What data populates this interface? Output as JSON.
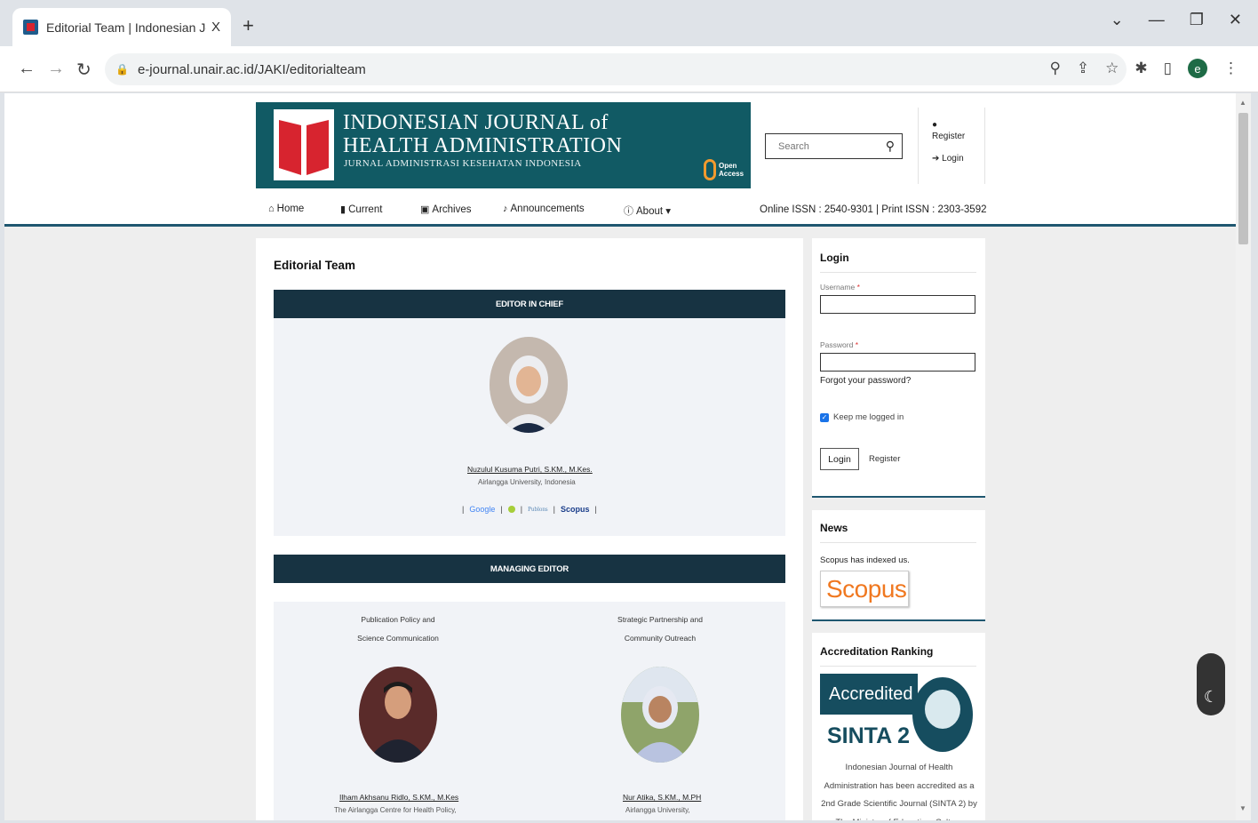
{
  "browser": {
    "tab_title": "Editorial Team | Indonesian Journ",
    "tab_close": "X",
    "new_tab": "+",
    "url": "e-journal.unair.ac.id/JAKI/editorialteam",
    "profile_initial": "e"
  },
  "journal": {
    "title_line1": "INDONESIAN JOURNAL of",
    "title_line2": "HEALTH ADMINISTRATION",
    "subtitle": "JURNAL ADMINISTRASI KESEHATAN INDONESIA",
    "open_access_line1": "Open",
    "open_access_line2": "Access"
  },
  "search": {
    "placeholder": "Search"
  },
  "user_menu": {
    "register": "Register",
    "login": "Login"
  },
  "nav": {
    "items": [
      {
        "label": "Home",
        "icon": "home-icon"
      },
      {
        "label": "Current",
        "icon": "book-icon"
      },
      {
        "label": "Archives",
        "icon": "archive-icon"
      },
      {
        "label": "Announcements",
        "icon": "bell-icon"
      },
      {
        "label": "About",
        "icon": "info-icon"
      }
    ],
    "about_caret": "▾",
    "issn": "Online ISSN : 2540-9301  |  Print ISSN : 2303-3592"
  },
  "main": {
    "page_title": "Editorial Team",
    "sections": [
      {
        "heading": "EDITOR IN CHIEF",
        "people": [
          {
            "name": "Nuzulul Kusuma Putri, S.KM., M.Kes.",
            "affiliation": "Airlangga University, Indonesia"
          }
        ],
        "profile_links": [
          "Google",
          "Publons",
          "Scopus"
        ],
        "link_sep": "|"
      },
      {
        "heading": "MANAGING EDITOR",
        "people": [
          {
            "role_line1": "Publication Policy and",
            "role_line2": "Science Communication",
            "name": "Ilham Akhsanu Ridlo, S.KM., M.Kes",
            "affiliation": "The Airlangga Centre for Health Policy,"
          },
          {
            "role_line1": "Strategic Partnership and",
            "role_line2": "Community Outreach",
            "name": "Nur Atika, S.KM., M.PH",
            "affiliation": "Airlangga University,"
          }
        ]
      }
    ]
  },
  "sidebar": {
    "login": {
      "title": "Login",
      "username_label": "Username",
      "password_label": "Password",
      "required_mark": "*",
      "forgot": "Forgot your password?",
      "keep_logged_in": "Keep me logged in",
      "login_button": "Login",
      "register_link": "Register"
    },
    "news": {
      "title": "News",
      "text": "Scopus has indexed us.",
      "logo_text": "Scopus"
    },
    "accreditation": {
      "title": "Accreditation Ranking",
      "badge_accredited": "Accredited",
      "badge_grade": "SINTA 2",
      "text": "Indonesian Journal of Health Administration has been accredited as a 2nd Grade Scientific Journal (SINTA 2) by The Ministry of Education, Culture"
    }
  },
  "colors": {
    "banner_teal": "#115a64",
    "section_bar": "#173342",
    "accent_border": "#1f5770",
    "scopus_orange": "#f07820"
  }
}
